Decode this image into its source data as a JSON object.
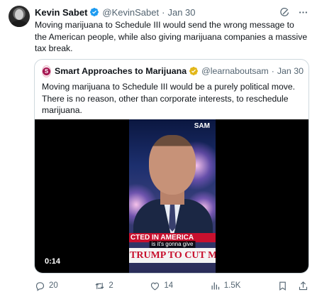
{
  "tweet": {
    "author_name": "Kevin Sabet",
    "author_handle": "@KevinSabet",
    "separator": "·",
    "date": "Jan 30",
    "text": "Moving marijuana to Schedule III would send the wrong message to the American people, while also giving marijuana companies a massive tax break."
  },
  "quote": {
    "author_name": "Smart Approaches to Marijuana",
    "author_handle": "@learnaboutsam",
    "separator": "·",
    "date": "Jan 30",
    "text": "Moving marijuana to Schedule III would be a purely political move. There is no reason, other than corporate interests, to reschedule marijuana.",
    "avatar_letter": "S",
    "video": {
      "logo": "SAM",
      "banner_top": "CTED IN AMERICA",
      "caption": "is it's gonna give",
      "banner_bottom": "TRUMP TO CUT MARIJUAN",
      "duration": "0:14"
    }
  },
  "actions": {
    "replies": "20",
    "reposts": "2",
    "likes": "14",
    "views": "1.5K"
  },
  "icons": {
    "verified": "verified-check-icon",
    "affiliate": "gold-affiliate-badge-icon",
    "grok": "grok-icon",
    "more": "more-dots-icon",
    "reply": "reply-icon",
    "repost": "repost-icon",
    "like": "heart-icon",
    "views": "views-chart-icon",
    "bookmark": "bookmark-icon",
    "share": "share-icon"
  },
  "colors": {
    "verified_blue": "#1d9bf0",
    "muted": "#536471",
    "text": "#0f1419",
    "gold": "#e2b719",
    "banner_red": "#c8102e"
  }
}
